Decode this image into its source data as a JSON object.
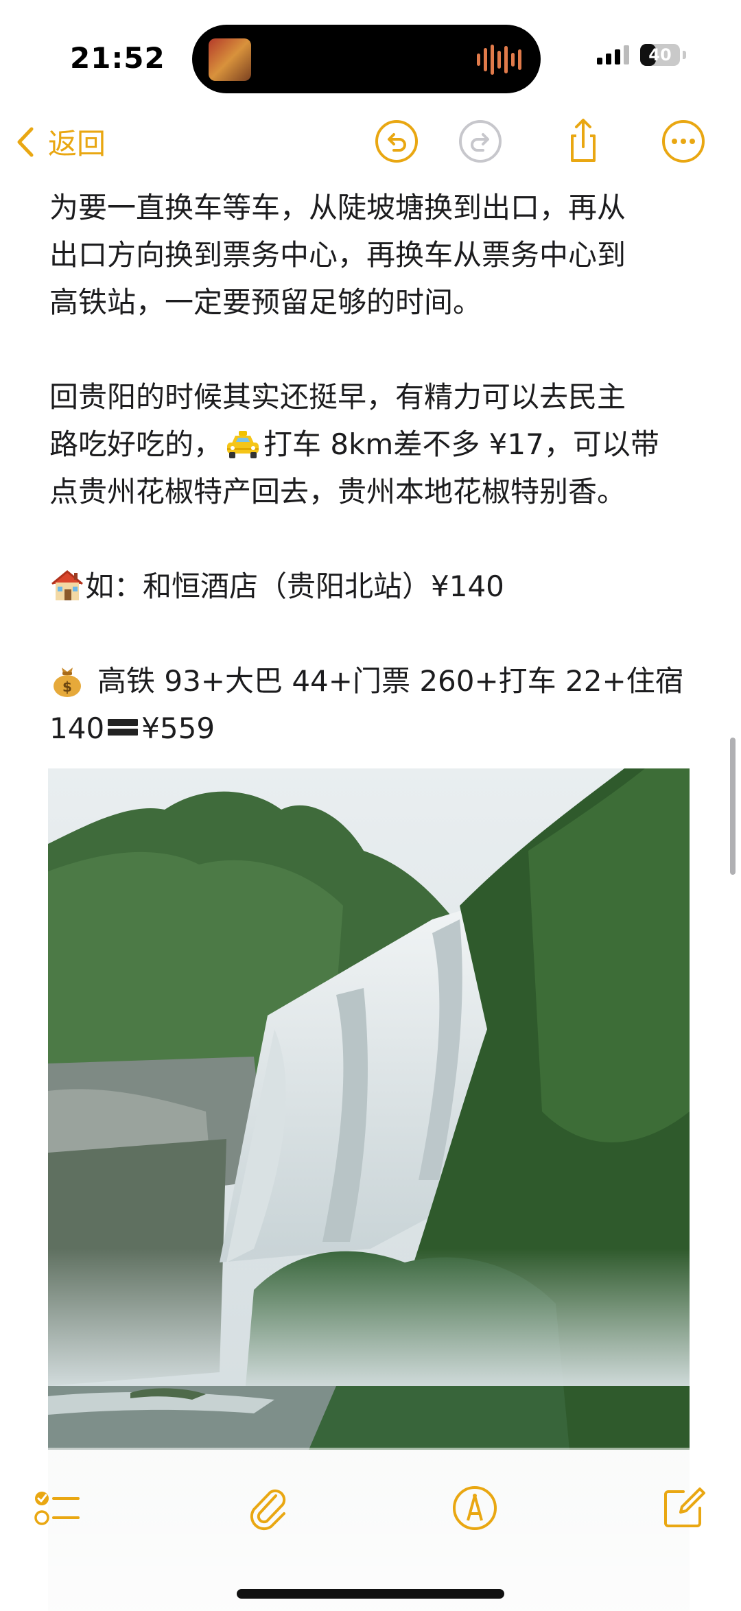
{
  "status_bar": {
    "time": "21:52",
    "battery_level": "40",
    "battery_fraction": 0.4,
    "island_icons": [
      "album-art-icon",
      "audio-waveform-icon"
    ]
  },
  "toolbar": {
    "back_label": "返回",
    "accent_color": "#e9a712",
    "icons": [
      "chevron-left-icon",
      "undo-icon",
      "redo-icon",
      "share-icon",
      "more-icon"
    ]
  },
  "note": {
    "paragraph1": [
      "为要一直换车等车，从陡坡塘换到出口，再从",
      "出口方向换到票务中心，再换车从票务中心到",
      "高铁站，一定要预留足够的时间。"
    ],
    "paragraph2": {
      "line1": "回贵阳的时候其实还挺早，有精力可以去民主",
      "line2_before": "路吃好吃的，",
      "line2_after": "打车 8km差不多 ¥17，可以带",
      "line3": "点贵州花椒特产回去，贵州本地花椒特别香。"
    },
    "hotel_line": "如：和恒酒店（贵阳北站）¥140",
    "cost_line1": "高铁 93+大巴 44+门票 260+打车 22+住宿",
    "cost_line2_before": "140",
    "cost_line2_after": "¥559",
    "emojis": [
      "taxi-icon",
      "house-icon",
      "money-bag-icon",
      "equals-icon"
    ]
  },
  "photo": {
    "subject": "waterfall-photo"
  },
  "bottom_bar": {
    "icons": [
      "checklist-icon",
      "attachment-icon",
      "markup-icon",
      "compose-icon"
    ]
  }
}
